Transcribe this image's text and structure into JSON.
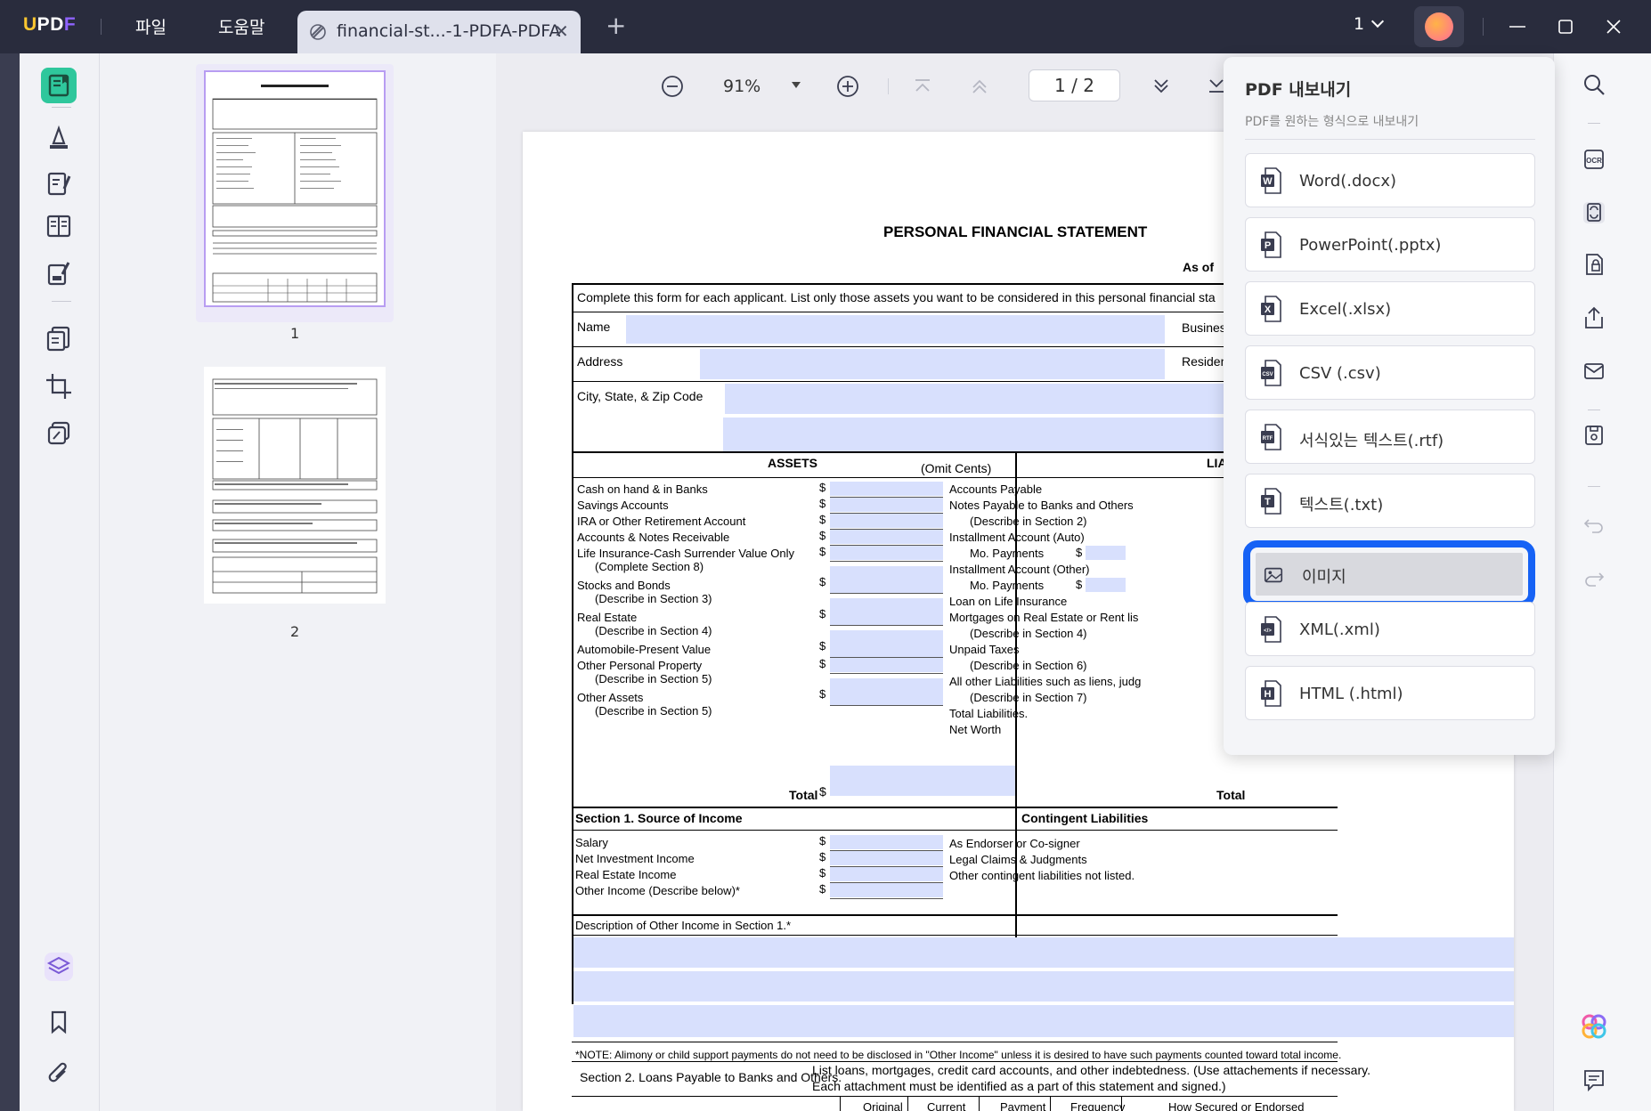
{
  "app": {
    "logo": "UPDF"
  },
  "menu": {
    "file": "파일",
    "help": "도움말"
  },
  "tab": {
    "title": "financial-st...-1-PDFA-PDFA"
  },
  "page_selector": {
    "value": "1"
  },
  "thumbnails": [
    {
      "label": "1"
    },
    {
      "label": "2"
    }
  ],
  "nav": {
    "zoom": "91%",
    "page_display": "1 / 2"
  },
  "export_panel": {
    "title": "PDF 내보내기",
    "subtitle": "PDF를 원하는 형식으로 내보내기",
    "options": [
      {
        "label": "Word(.docx)",
        "icon": "word-icon"
      },
      {
        "label": "PowerPoint(.pptx)",
        "icon": "powerpoint-icon"
      },
      {
        "label": "Excel(.xlsx)",
        "icon": "excel-icon"
      },
      {
        "label": "CSV (.csv)",
        "icon": "csv-icon"
      },
      {
        "label": "서식있는 텍스트(.rtf)",
        "icon": "rtf-icon"
      },
      {
        "label": "텍스트(.txt)",
        "icon": "txt-icon"
      },
      {
        "label": "이미지",
        "icon": "image-icon",
        "selected": true
      },
      {
        "label": "XML(.xml)",
        "icon": "xml-icon"
      },
      {
        "label": "HTML (.html)",
        "icon": "html-icon"
      }
    ]
  },
  "doc": {
    "title": "PERSONAL FINANCIAL STATEMENT",
    "as_of": "As of",
    "instruction": "Complete this form for each applicant.  List only those assets you want to be considered in this personal financial sta",
    "name": "Name",
    "business": "Busines",
    "address": "Address",
    "residence": "Residen",
    "city": "City, State, & Zip Code",
    "assets_header": "ASSETS",
    "omit_cents": "(Omit Cents)",
    "liab_header": "LIA",
    "assets": [
      {
        "l1": "Cash on hand & in Banks",
        "l2": ""
      },
      {
        "l1": "Savings Accounts",
        "l2": ""
      },
      {
        "l1": "IRA or Other Retirement Account",
        "l2": ""
      },
      {
        "l1": "Accounts & Notes Receivable",
        "l2": ""
      },
      {
        "l1": "Life Insurance-Cash Surrender Value Only",
        "l2": "(Complete Section 8)"
      },
      {
        "l1": "Stocks and Bonds",
        "l2": "(Describe in Section 3)"
      },
      {
        "l1": "Real Estate",
        "l2": "(Describe in Section 4)"
      },
      {
        "l1": "Automobile-Present Value",
        "l2": ""
      },
      {
        "l1": "Other Personal Property",
        "l2": "(Describe in Section 5)"
      },
      {
        "l1": "Other Assets",
        "l2": "(Describe in Section 5)"
      }
    ],
    "liabilities": [
      "Accounts Payable",
      "Notes Payable to Banks and Others",
      "(Describe in Section 2)",
      "Installment Account (Auto)",
      "Mo. Payments",
      "Installment Account (Other)",
      "Mo. Payments",
      "Loan on Life Insurance",
      "Mortgages on Real Estate or Rent lis",
      "(Describe in Section 4)",
      "Unpaid Taxes",
      "(Describe in Section 6)",
      "All other Liabilities such as liens, judg",
      "(Describe in Section 7)",
      "Total Liabilities.",
      "Net Worth"
    ],
    "total": "Total",
    "dollar": "$",
    "section1": "Section 1.     Source of Income",
    "contingent": "Contingent Liabilities",
    "income": [
      "Salary",
      "Net Investment Income",
      "Real Estate Income",
      "Other Income (Describe below)*"
    ],
    "contingent_items": [
      "As Endorser or Co-signer",
      "Legal Claims & Judgments",
      "Other contingent liabilities not listed."
    ],
    "other_income_desc": "Description of Other Income in Section 1.*",
    "note": "*NOTE: Alimony or child support payments do not need to be disclosed in \"Other Income\" unless it is desired to have such payments counted toward total income.",
    "section2": "Section 2. Loans Payable to Banks and Others.",
    "section2_desc1": "List loans, mortgages, credit card accounts, and other indebtedness. (Use attachements if necessary.",
    "section2_desc2": "Each attachment must be identified as a part of this statement and signed.)",
    "col_headers": [
      "Original",
      "Current",
      "Payment",
      "Frequency",
      "How Secured or Endorsed"
    ]
  }
}
